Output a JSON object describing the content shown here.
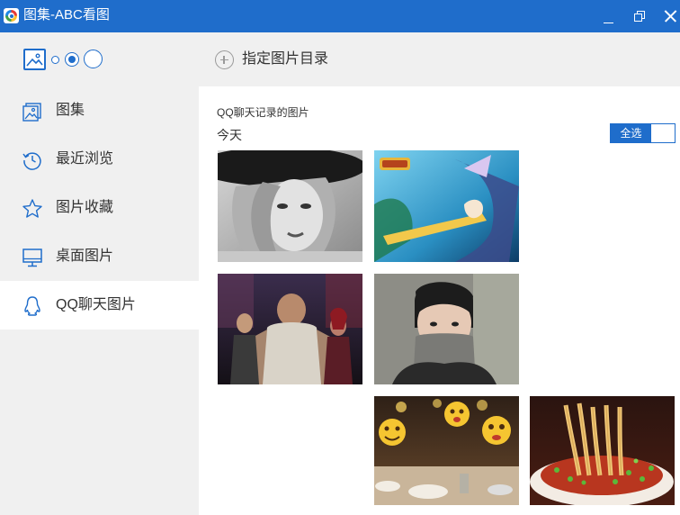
{
  "window": {
    "title": "图集-ABC看图",
    "controls": [
      "minimize",
      "restore",
      "close"
    ]
  },
  "sidebar": {
    "view_sizes": [
      "small",
      "medium",
      "large"
    ],
    "view_selected": "medium",
    "items": [
      {
        "label": "图集",
        "icon": "album-icon",
        "active": false
      },
      {
        "label": "最近浏览",
        "icon": "history-icon",
        "active": false
      },
      {
        "label": "图片收藏",
        "icon": "star-icon",
        "active": false
      },
      {
        "label": "桌面图片",
        "icon": "monitor-icon",
        "active": false
      },
      {
        "label": "QQ聊天图片",
        "icon": "qq-penguin-icon",
        "active": true
      }
    ]
  },
  "toolbar": {
    "add_directory_label": "指定图片目录"
  },
  "content": {
    "section_title": "QQ聊天记录的图片",
    "date_group": "今天",
    "select_all_label": "全选"
  },
  "colors": {
    "accent": "#1f6dcb",
    "sidebar_bg": "#f0f0f0"
  }
}
